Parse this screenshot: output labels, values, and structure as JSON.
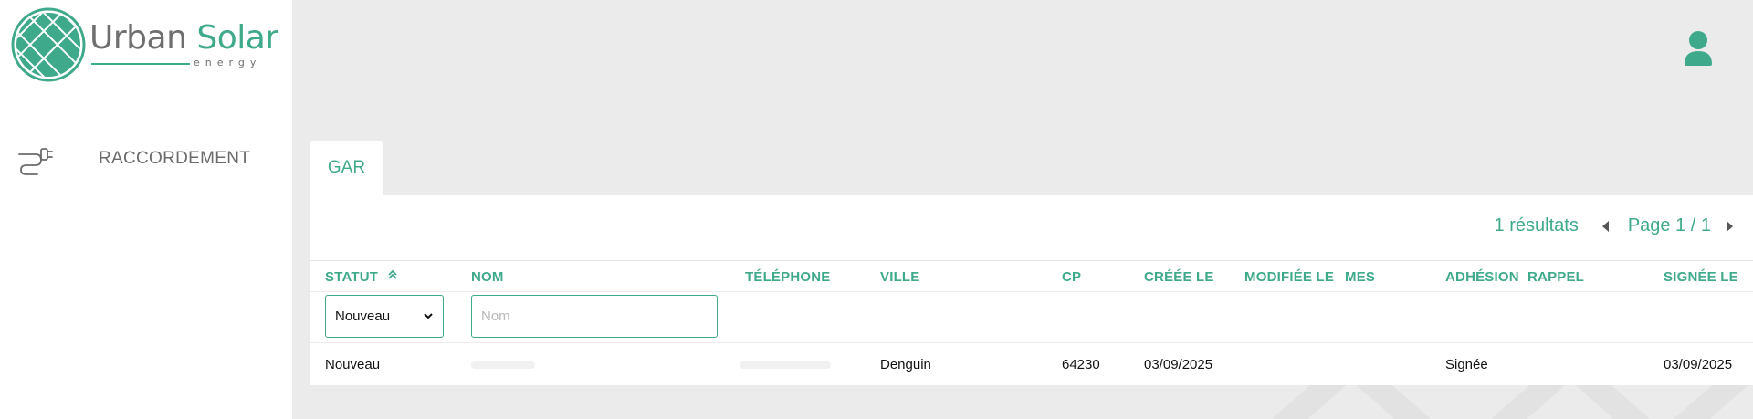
{
  "brand": {
    "name_part1": "Urban",
    "name_part2": "Solar",
    "tagline": "energy",
    "color": "#3fa98c"
  },
  "sidebar": {
    "items": [
      {
        "label": "RACCORDEMENT",
        "icon": "plug-icon"
      }
    ]
  },
  "header": {
    "user_icon": "user-icon"
  },
  "tabs": [
    {
      "label": "GAR",
      "active": true
    }
  ],
  "pagination": {
    "results": "1 résultats",
    "page": "Page 1 / 1"
  },
  "table": {
    "columns": [
      "STATUT",
      "NOM",
      "TÉLÉPHONE",
      "VILLE",
      "CP",
      "CRÉÉE LE",
      "MODIFIÉE LE",
      "MES",
      "ADHÉSION",
      "RAPPEL",
      "SIGNÉE LE"
    ],
    "sort": {
      "column": "STATUT",
      "icon": "double-chevron-up-icon"
    },
    "filters": {
      "statut_value": "Nouveau",
      "nom_placeholder": "Nom"
    },
    "rows": [
      {
        "statut": "Nouveau",
        "nom": "",
        "telephone": "",
        "ville": "Denguin",
        "cp": "64230",
        "creee_le": "03/09/2025",
        "modifiee_le": "",
        "mes": "",
        "adhesion": "Signée",
        "rappel": "",
        "signee_le": "03/09/2025"
      }
    ]
  }
}
